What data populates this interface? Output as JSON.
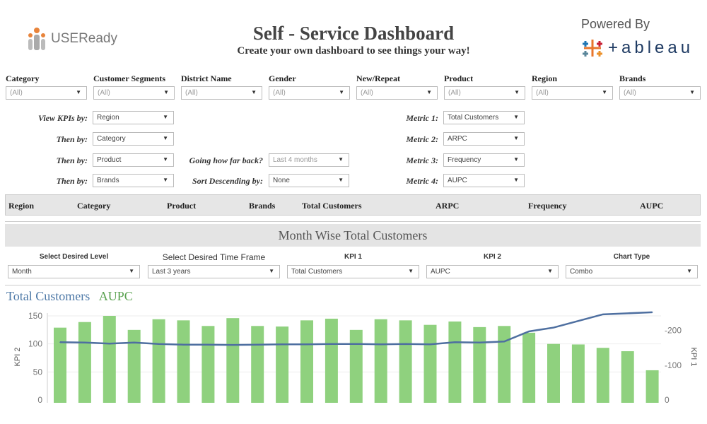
{
  "header": {
    "logo_text": "USEReady",
    "title": "Self - Service Dashboard",
    "subtitle": "Create your own dashboard to see things your way!",
    "powered_by": "Powered By",
    "tableau_logo": "+ableau"
  },
  "filters": [
    {
      "label": "Category",
      "value": "(All)"
    },
    {
      "label": "Customer Segments",
      "value": "(All)"
    },
    {
      "label": "District Name",
      "value": "(All)"
    },
    {
      "label": "Gender",
      "value": "(All)"
    },
    {
      "label": "New/Repeat",
      "value": "(All)"
    },
    {
      "label": "Product",
      "value": "(All)"
    },
    {
      "label": "Region",
      "value": "(All)"
    },
    {
      "label": "Brands",
      "value": "(All)"
    }
  ],
  "params": {
    "view_by": [
      {
        "label": "View KPIs by:",
        "value": "Region"
      },
      {
        "label": "Then by:",
        "value": "Category"
      },
      {
        "label": "Then by:",
        "value": "Product"
      },
      {
        "label": "Then by:",
        "value": "Brands"
      }
    ],
    "going_back": {
      "label": "Going how far back?",
      "value": "Last 4 months"
    },
    "sort_desc": {
      "label": "Sort Descending by:",
      "value": "None"
    },
    "metrics": [
      {
        "label": "Metric 1:",
        "value": "Total Customers"
      },
      {
        "label": "Metric 2:",
        "value": "ARPC"
      },
      {
        "label": "Metric 3:",
        "value": "Frequency"
      },
      {
        "label": "Metric 4:",
        "value": "AUPC"
      }
    ]
  },
  "table_headers": [
    "Region",
    "Category",
    "Product",
    "Brands",
    "Total Customers",
    "ARPC",
    "Frequency",
    "AUPC"
  ],
  "section_title": "Month Wise Total Customers",
  "controls": [
    {
      "label": "Select Desired Level",
      "value": "Month"
    },
    {
      "label": "Select Desired Time Frame",
      "value": "Last 3 years"
    },
    {
      "label": "KPI 1",
      "value": "Total Customers"
    },
    {
      "label": "KPI 2",
      "value": "AUPC"
    },
    {
      "label": "Chart Type",
      "value": "Combo"
    }
  ],
  "chart_data": {
    "type": "bar",
    "legend": [
      {
        "name": "Total Customers",
        "color": "#4e79a7"
      },
      {
        "name": "AUPC",
        "color": "#59a14f"
      }
    ],
    "ylabel_left": "KPI 2",
    "ylabel_right": "KPI 1",
    "left_ticks": [
      "0",
      "50",
      "100",
      "150"
    ],
    "right_ticks": [
      "0",
      "100",
      "200"
    ],
    "ylim_left": [
      0,
      160
    ],
    "ylim_right": [
      0,
      270
    ],
    "series": [
      {
        "name": "AUPC",
        "axis": "KPI 2",
        "type": "bar",
        "color": "#8fd17e",
        "values": [
          129,
          139,
          150,
          125,
          144,
          142,
          132,
          146,
          132,
          131,
          142,
          145,
          125,
          144,
          142,
          134,
          140,
          130,
          132,
          120,
          100,
          99,
          93,
          87,
          53
        ]
      },
      {
        "name": "Total Customers",
        "axis": "KPI 1",
        "type": "line",
        "color": "#4e6fa0",
        "values": [
          166,
          165,
          162,
          165,
          161,
          159,
          159,
          158,
          159,
          160,
          160,
          161,
          161,
          160,
          161,
          160,
          166,
          165,
          168,
          197,
          208,
          227,
          246,
          249,
          252
        ]
      }
    ]
  }
}
